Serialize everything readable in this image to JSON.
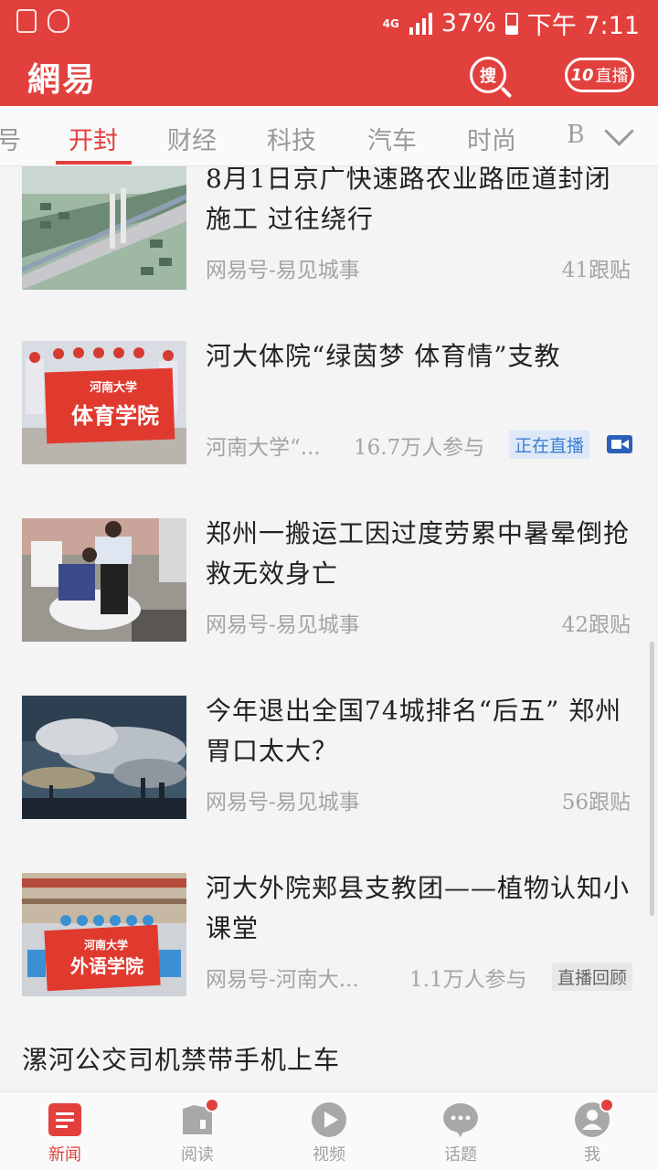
{
  "status_bar": {
    "network": "4G",
    "battery": "37%",
    "time": "下午 7:11"
  },
  "header": {
    "logo": "網易",
    "search_label": "搜",
    "live_count": "10",
    "live_label": "直播"
  },
  "tabs": {
    "items": [
      "号",
      "开封",
      "财经",
      "科技",
      "汽车",
      "时尚",
      "B"
    ],
    "active": "开封"
  },
  "feed": {
    "items": [
      {
        "title": "8月1日京广快速路农业路匝道封闭施工 过往绕行",
        "source": "网易号-易见城事",
        "count": "41跟贴",
        "thumb": "highway-rendering"
      },
      {
        "title": "河大体院“绿茵梦 体育情”支教",
        "source": "河南大学“...",
        "count": "16.7万人参与",
        "badge": "正在直播",
        "banner_top": "河南大学",
        "banner_main": "体育学院",
        "thumb": "group-with-banner"
      },
      {
        "title": "郑州一搬运工因过度劳累中暑晕倒抢救无效身亡",
        "source": "网易号-易见城事",
        "count": "42跟贴",
        "thumb": "street-rescue"
      },
      {
        "title": "今年退出全国74城排名“后五” 郑州胃口太大？",
        "source": "网易号-易见城事",
        "count": "56跟贴",
        "thumb": "smoke-stacks"
      },
      {
        "title": "河大外院郏县支教团——植物认知小课堂",
        "source": "网易号-河南大...",
        "count": "1.1万人参与",
        "badge": "直播回顾",
        "banner_top": "河南大学",
        "banner_main": "外语学院",
        "thumb": "group-with-banner"
      },
      {
        "title": "漯河公交司机禁带手机上车"
      }
    ]
  },
  "bottom_nav": {
    "items": [
      {
        "label": "新闻",
        "icon": "news-icon",
        "active": true
      },
      {
        "label": "阅读",
        "icon": "reading-icon"
      },
      {
        "label": "视频",
        "icon": "video-play-icon"
      },
      {
        "label": "话题",
        "icon": "topic-chat-icon"
      },
      {
        "label": "我",
        "icon": "profile-icon"
      }
    ]
  },
  "colors": {
    "brand_red": "#e2403d",
    "text_muted": "#a4a4a4",
    "live_badge_blue": "#3b7fd1"
  }
}
